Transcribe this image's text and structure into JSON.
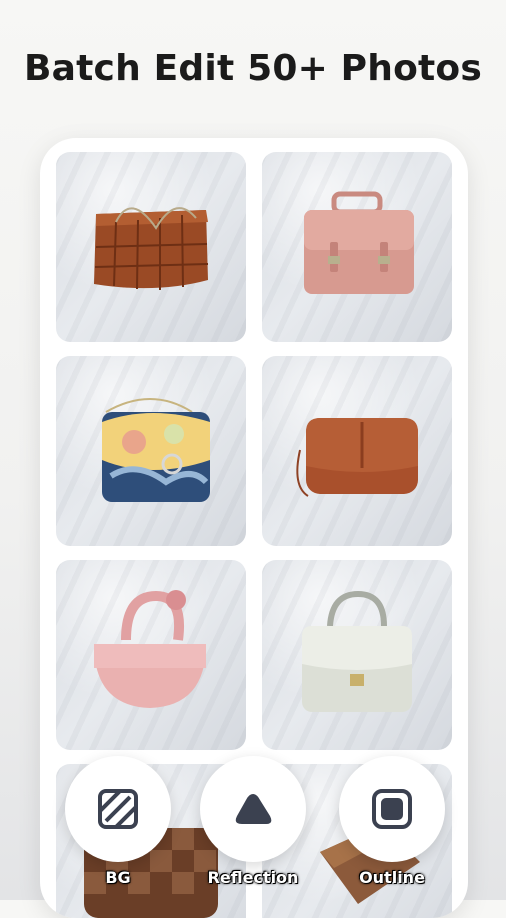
{
  "headline": "Batch Edit 50+ Photos",
  "gallery": {
    "items": [
      {
        "name": "brown woven tote"
      },
      {
        "name": "pink satchel"
      },
      {
        "name": "floral handbag"
      },
      {
        "name": "tan crossbody"
      },
      {
        "name": "pink half-moon bag"
      },
      {
        "name": "silver top-handle bag"
      },
      {
        "name": "checkered bag"
      },
      {
        "name": "cork bag"
      }
    ]
  },
  "actions": {
    "bg": {
      "label": "BG",
      "icon": "stripes-square-icon"
    },
    "reflection": {
      "label": "Reflection",
      "icon": "reflection-shape-icon"
    },
    "outline": {
      "label": "Outline",
      "icon": "outline-square-icon"
    }
  },
  "colors": {
    "icon_dark": "#3b4150",
    "text_dark": "#1b1b1b"
  }
}
